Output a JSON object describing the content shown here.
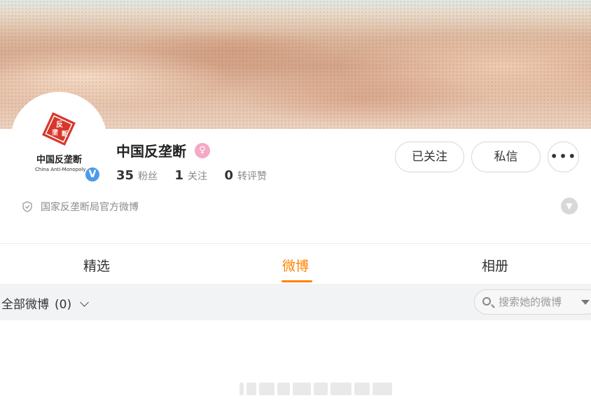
{
  "profile": {
    "name": "中国反垄断",
    "avatar_text_cn": "中国反垄断",
    "avatar_text_en": "China Anti-Monopoly",
    "avatar_emblem": "反垄断",
    "verified_mark": "V",
    "gender_icon": "female-icon",
    "description": "国家反垄断局官方微博",
    "stats": [
      {
        "value": "35",
        "label": "粉丝"
      },
      {
        "value": "1",
        "label": "关注"
      },
      {
        "value": "0",
        "label": "转评赞"
      }
    ]
  },
  "actions": {
    "follow_label": "已关注",
    "message_label": "私信",
    "more_label": "•••"
  },
  "tabs": [
    {
      "label": "精选",
      "active": false
    },
    {
      "label": "微博",
      "active": true
    },
    {
      "label": "相册",
      "active": false
    }
  ],
  "filter": {
    "label": "全部微博",
    "count": "(0)"
  },
  "search": {
    "placeholder": "搜索她的微博"
  },
  "colors": {
    "accent": "#ff8200",
    "verified": "#4c9bea",
    "badge": "#f4a9c6",
    "emblem": "#d9372b"
  }
}
